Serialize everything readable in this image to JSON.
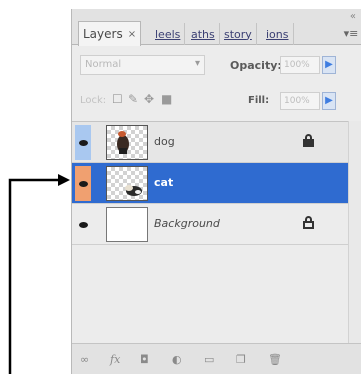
{
  "panel": {
    "tabs": [
      {
        "label": "Layers",
        "active": true
      },
      {
        "label": "leels",
        "active": false
      },
      {
        "label": "aths",
        "active": false
      },
      {
        "label": "story",
        "active": false
      },
      {
        "label": "ions",
        "active": false
      }
    ],
    "tab_close": "×",
    "menu_glyph": "▾≡",
    "collapse_glyph": "«"
  },
  "controls": {
    "blend_mode": "Normal",
    "opacity_label": "Opacity:",
    "opacity_value": "100%",
    "lock_label": "Lock:",
    "fill_label": "Fill:",
    "fill_value": "100%"
  },
  "layers": [
    {
      "name": "dog",
      "visible": true,
      "selected": false,
      "locked": "full",
      "thumb": "dog"
    },
    {
      "name": "cat",
      "visible": true,
      "selected": true,
      "locked": "none",
      "thumb": "cat"
    },
    {
      "name": "Background",
      "visible": true,
      "selected": false,
      "locked": "outline",
      "thumb": "plain"
    }
  ],
  "toolbar_icons": [
    "link-layers-icon",
    "layer-style-icon",
    "layer-mask-icon",
    "adjustment-layer-icon",
    "new-group-icon",
    "new-layer-icon",
    "delete-layer-icon"
  ],
  "colors": {
    "selected_row": "#2f6bd0",
    "eye_cell_blue": "#a9c8f0",
    "eye_cell_orange": "#f0a070",
    "arrow": "#000000"
  }
}
